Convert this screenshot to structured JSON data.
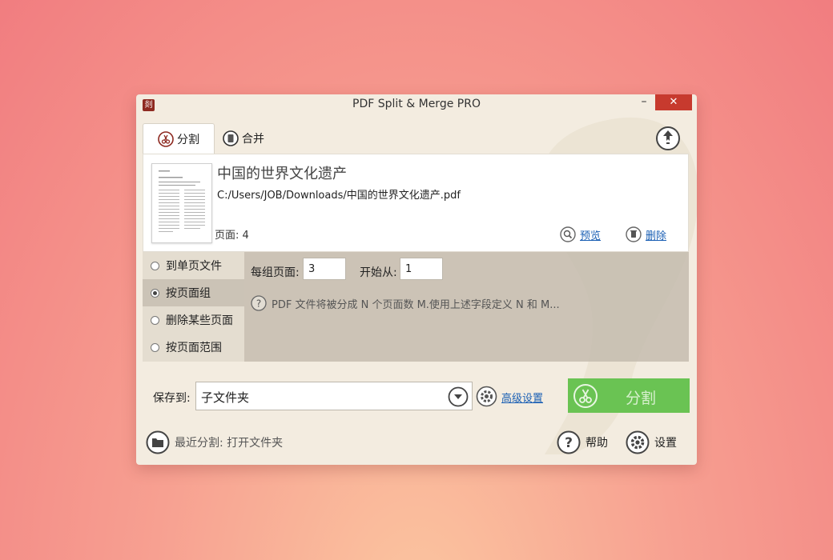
{
  "window": {
    "title": "PDF Split & Merge PRO",
    "logo_glyph": "剡",
    "minimize_glyph": "–",
    "close_glyph": "✕"
  },
  "tabs": [
    {
      "label": "分割",
      "icon": "scissors-icon",
      "active": true
    },
    {
      "label": "合并",
      "icon": "merge-icon",
      "active": false
    }
  ],
  "file": {
    "name": "中国的世界文化遗产",
    "path": "C:/Users/JOB/Downloads/中国的世界文化遗产.pdf",
    "pages_label": "页面: 4",
    "preview_label": "预览",
    "delete_label": "删除"
  },
  "modes": [
    {
      "label": "到单页文件",
      "selected": false
    },
    {
      "label": "按页面组",
      "selected": true
    },
    {
      "label": "删除某些页面",
      "selected": false
    },
    {
      "label": "按页面范围",
      "selected": false
    }
  ],
  "group_options": {
    "per_group_label": "每组页面:",
    "per_group_value": "3",
    "start_label": "开始从:",
    "start_value": "1",
    "hint": "PDF 文件将被分成 N 个页面数 M.使用上述字段定义 N 和 M..."
  },
  "save": {
    "label": "保存到:",
    "value": "子文件夹",
    "advanced_label": "高级设置"
  },
  "split_button_label": "分割",
  "footer": {
    "recent_label": "最近分割: 打开文件夹",
    "help_label": "帮助",
    "settings_label": "设置"
  },
  "colors": {
    "accent_green": "#6ac353",
    "close_red": "#c73a2e",
    "link_blue": "#1a5fb4",
    "window_bg": "#f3ece0"
  }
}
